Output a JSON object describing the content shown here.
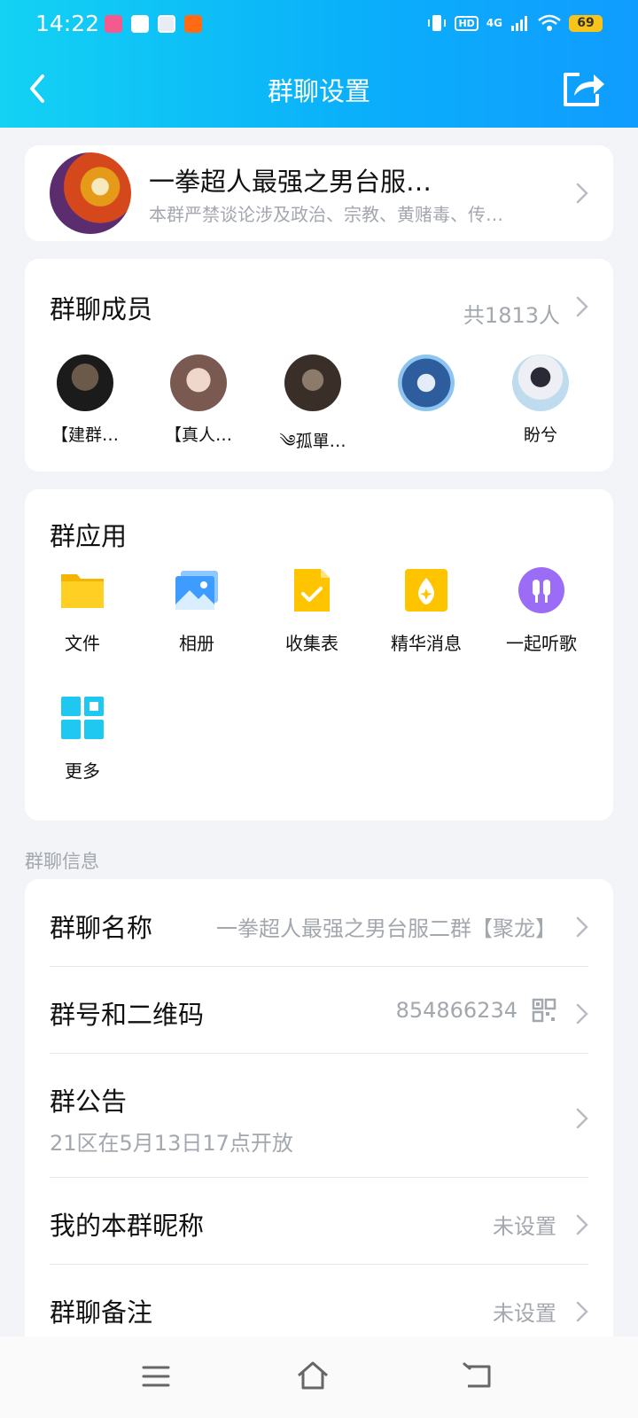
{
  "status_bar": {
    "time": "14:22",
    "hd_badge": "HD",
    "network": "4G",
    "battery": "69",
    "app_icons": [
      "bilibili-icon",
      "white-square-icon",
      "game-icon",
      "taobao-icon"
    ]
  },
  "nav": {
    "title": "群聊设置",
    "back_icon": "back-icon",
    "share_icon": "share-icon"
  },
  "group": {
    "name": "一拳超人最强之男台服…",
    "description": "本群严禁谈论涉及政治、宗教、黄赌毒、传…"
  },
  "members": {
    "title": "群聊成员",
    "count": "共1813人",
    "list": [
      {
        "name": "【建群…",
        "color": "#1B1B1B"
      },
      {
        "name": "【真人…",
        "color": "#C9A99B"
      },
      {
        "name": "༄孤單…",
        "color": "#4A3B33"
      },
      {
        "name": "",
        "color": "#2E5D9E"
      },
      {
        "name": "盼兮",
        "color": "#BFDCEF"
      }
    ]
  },
  "group_apps": {
    "title": "群应用",
    "items": [
      {
        "label": "文件",
        "icon": "folder-icon"
      },
      {
        "label": "相册",
        "icon": "album-icon"
      },
      {
        "label": "收集表",
        "icon": "form-icon"
      },
      {
        "label": "精华消息",
        "icon": "essence-icon"
      },
      {
        "label": "一起听歌",
        "icon": "earphones-icon"
      },
      {
        "label": "更多",
        "icon": "more-grid-icon"
      }
    ]
  },
  "info": {
    "section_label": "群聊信息",
    "name_label": "群聊名称",
    "name_value": "一拳超人最强之男台服二群【聚龙】",
    "id_label": "群号和二维码",
    "id_value": "854866234",
    "notice_label": "群公告",
    "notice_value": "21区在5月13日17点开放",
    "nickname_label": "我的本群昵称",
    "nickname_value": "未设置",
    "remark_label": "群聊备注",
    "remark_value": "未设置"
  },
  "colors": {
    "header_start": "#13D2F3",
    "header_end": "#109CFF",
    "page_bg": "#F2F4F8",
    "secondary_text": "#A3A7AE"
  }
}
